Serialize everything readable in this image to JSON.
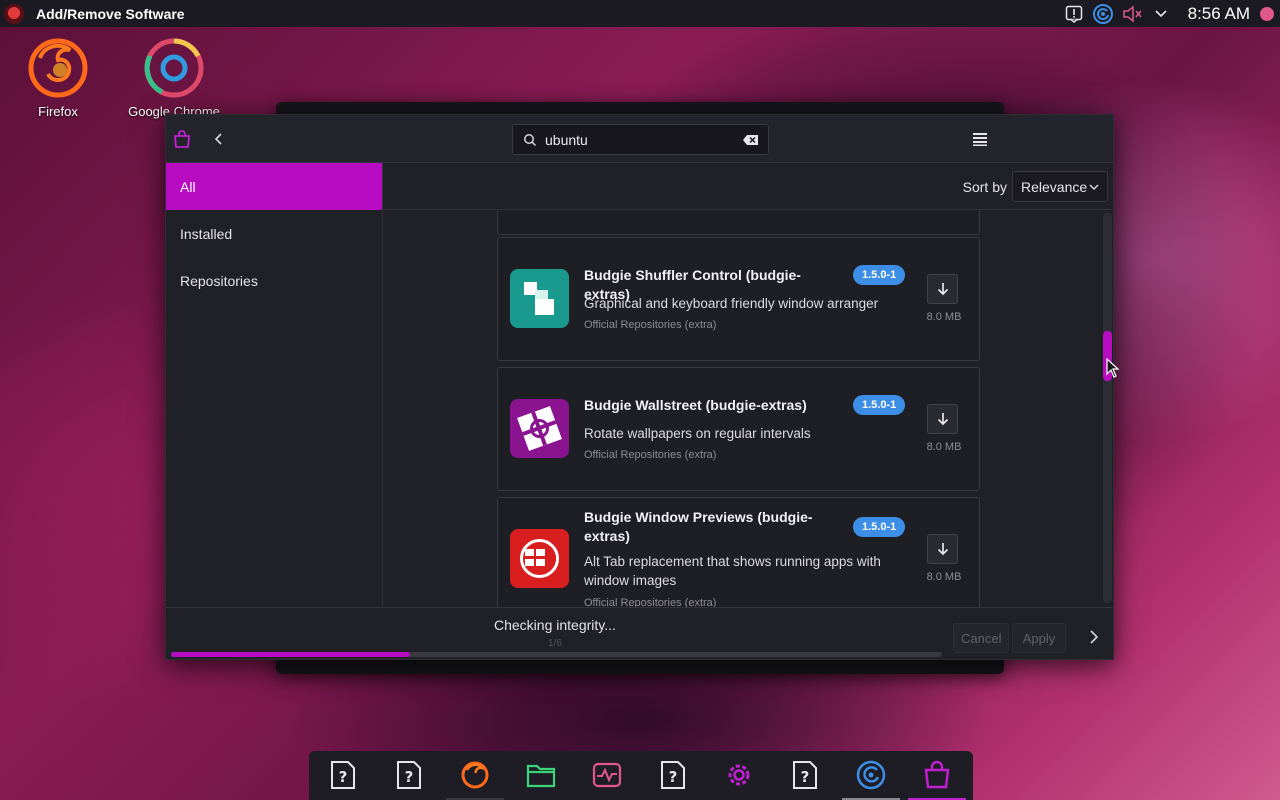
{
  "top_panel": {
    "title": "Add/Remove Software",
    "clock": "8:56 AM",
    "tray_icons": [
      "alert-icon",
      "sync-icon",
      "volume-muted-icon",
      "chevron-down-icon"
    ]
  },
  "desktop": {
    "icons": [
      {
        "label": "Firefox",
        "icon": "firefox-icon"
      },
      {
        "label": "Google Chrome",
        "icon": "chrome-icon"
      }
    ]
  },
  "window": {
    "search": {
      "value": "ubuntu",
      "placeholder": ""
    },
    "sidebar": {
      "items": [
        {
          "label": "All",
          "active": true
        },
        {
          "label": "Installed",
          "active": false
        },
        {
          "label": "Repositories",
          "active": false
        }
      ]
    },
    "sort": {
      "label": "Sort by",
      "value": "Relevance"
    },
    "packages": [
      {
        "name": "Budgie Shuffler Control (budgie-extras)",
        "version": "1.5.0-1",
        "description": "Graphical and keyboard friendly window arranger",
        "repository": "Official Repositories (extra)",
        "size": "8.0 MB",
        "icon": "shuffler-icon",
        "color": "#1a9a8e"
      },
      {
        "name": "Budgie Wallstreet (budgie-extras)",
        "version": "1.5.0-1",
        "description": "Rotate wallpapers on regular intervals",
        "repository": "Official Repositories (extra)",
        "size": "8.0 MB",
        "icon": "wallstreet-icon",
        "color": "#8a1490"
      },
      {
        "name": "Budgie Window Previews (budgie-extras)",
        "version": "1.5.0-1",
        "description": "Alt Tab replacement that shows running apps with window images",
        "repository": "Official Repositories (extra)",
        "size": "8.0 MB",
        "icon": "window-previews-icon",
        "color": "#d81e1e"
      }
    ],
    "footer": {
      "status": "Checking integrity...",
      "progress_count": "1/6",
      "progress": 0.31,
      "cancel_label": "Cancel",
      "apply_label": "Apply"
    }
  },
  "colors": {
    "accent": "#b80cc2",
    "version_badge": "#3d8ee6",
    "window_bg": "#202027"
  },
  "dock": {
    "items": [
      "unknown-file-icon",
      "unknown-file-icon",
      "firefox-icon",
      "files-icon",
      "system-monitor-icon",
      "unknown-file-icon",
      "settings-icon",
      "unknown-file-icon",
      "sync-icon",
      "software-store-icon"
    ]
  }
}
